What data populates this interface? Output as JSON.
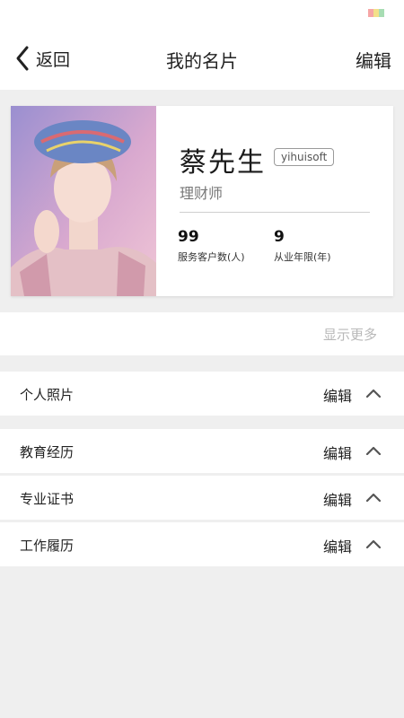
{
  "status_bar": {
    "battery_colors": [
      "#f6a6a6",
      "#f3e08a",
      "#a7ddb3"
    ]
  },
  "header": {
    "back_label": "返回",
    "title": "我的名片",
    "edit_label": "编辑"
  },
  "profile": {
    "name": "蔡先生",
    "company_tag": "yihuisoft",
    "role": "理财师",
    "stats": [
      {
        "value": "99",
        "label": "服务客户数(人)"
      },
      {
        "value": "9",
        "label": "从业年限(年)"
      }
    ]
  },
  "show_more_label": "显示更多",
  "sections": [
    {
      "label": "个人照片",
      "edit_label": "编辑"
    },
    {
      "label": "教育经历",
      "edit_label": "编辑"
    },
    {
      "label": "专业证书",
      "edit_label": "编辑"
    },
    {
      "label": "工作履历",
      "edit_label": "编辑"
    }
  ],
  "colors": {
    "page_background": "#efefef",
    "card_background": "#ffffff",
    "muted_text": "#b8b8b8"
  },
  "icons": {
    "back": "chevron-left-icon",
    "collapse": "chevron-up-icon"
  }
}
